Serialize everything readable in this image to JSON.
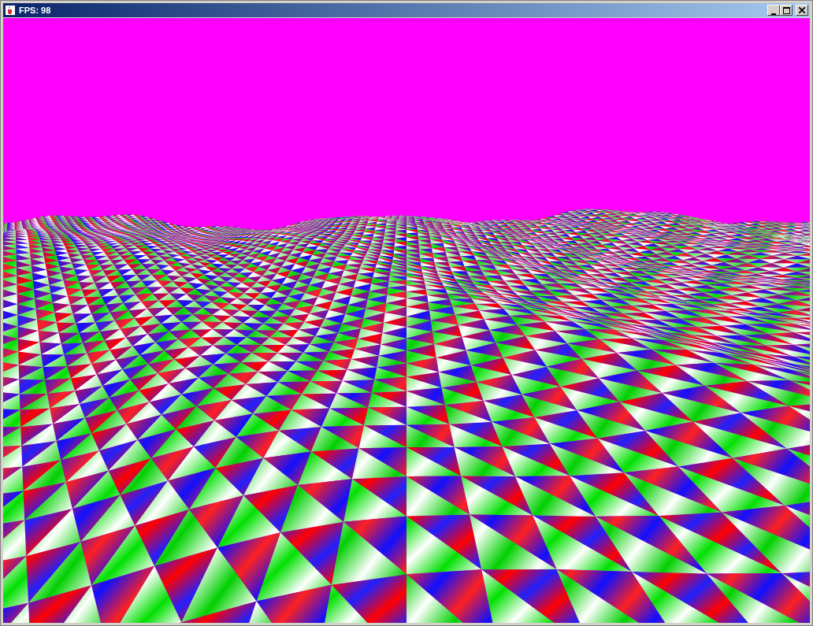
{
  "window": {
    "title": "FPS: 98"
  }
}
